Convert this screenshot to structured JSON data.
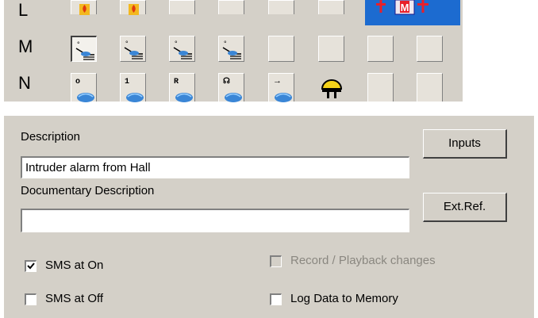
{
  "grid": {
    "row_labels": [
      "L",
      "M",
      "N"
    ],
    "row_n_glyphs": [
      "o",
      "1",
      "R",
      "☊",
      "→"
    ],
    "toolbar_letter": "M"
  },
  "form": {
    "description_label": "Description",
    "description_value": "Intruder alarm from Hall",
    "doc_description_label": "Documentary Description",
    "doc_description_value": "",
    "inputs_button": "Inputs",
    "extref_button": "Ext.Ref.",
    "sms_on_label": "SMS at On",
    "sms_on_checked": true,
    "sms_off_label": "SMS at Off",
    "sms_off_checked": false,
    "record_label": "Record / Playback changes",
    "record_checked": false,
    "log_label": "Log Data to Memory",
    "log_checked": false
  }
}
